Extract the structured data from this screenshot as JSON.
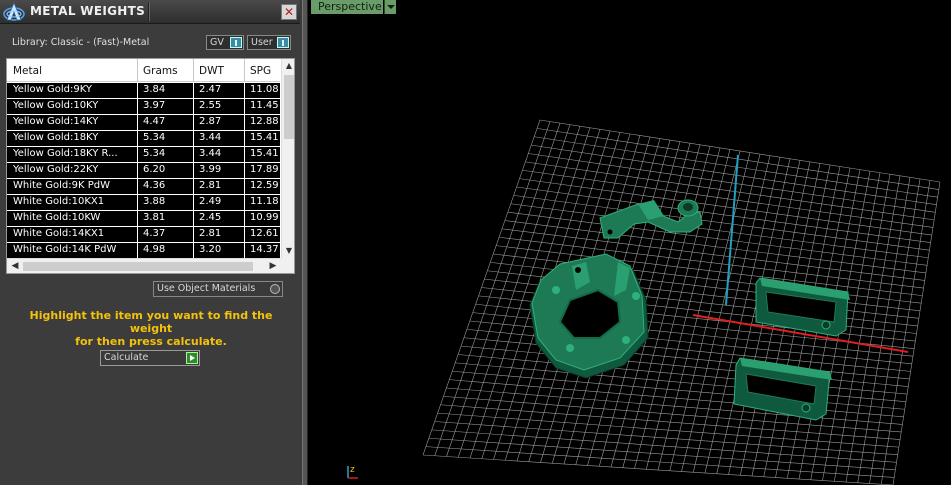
{
  "panel": {
    "title": "METAL WEIGHTS",
    "close_label": "✕",
    "library_label": "Library: Classic - (Fast)-Metal",
    "toggles": {
      "gv": "GV",
      "user": "User"
    },
    "use_object_materials": "Use Object Materials",
    "instruction_line1": "Highlight the item you want to find the weight",
    "instruction_line2": "for then press calculate.",
    "calculate_label": "Calculate"
  },
  "table": {
    "columns": [
      "Metal",
      "Grams",
      "DWT",
      "SPG"
    ],
    "rows": [
      [
        "Yellow Gold:9KY",
        "3.84",
        "2.47",
        "11.08"
      ],
      [
        "Yellow Gold:10KY",
        "3.97",
        "2.55",
        "11.45"
      ],
      [
        "Yellow Gold:14KY",
        "4.47",
        "2.87",
        "12.88"
      ],
      [
        "Yellow Gold:18KY",
        "5.34",
        "3.44",
        "15.41"
      ],
      [
        "Yellow Gold:18KY R...",
        "5.34",
        "3.44",
        "15.41"
      ],
      [
        "Yellow Gold:22KY",
        "6.20",
        "3.99",
        "17.89"
      ],
      [
        "White Gold:9K PdW",
        "4.36",
        "2.81",
        "12.59"
      ],
      [
        "White Gold:10KX1",
        "3.88",
        "2.49",
        "11.18"
      ],
      [
        "White Gold:10KW",
        "3.81",
        "2.45",
        "10.99"
      ],
      [
        "White Gold:14KX1",
        "4.37",
        "2.81",
        "12.61"
      ],
      [
        "White Gold:14K PdW",
        "4.98",
        "3.20",
        "14.37"
      ]
    ]
  },
  "viewport": {
    "label": "Perspective",
    "axis_label": "z"
  },
  "colors": {
    "panel_bg": "#3c3c3c",
    "instruction": "#f4c20d",
    "model": "#1e7a55",
    "grid": "#9a9a9a",
    "x_axis": "#e02020",
    "y_axis": "#20a0c0",
    "viewport_label": "#6a9c6a"
  }
}
